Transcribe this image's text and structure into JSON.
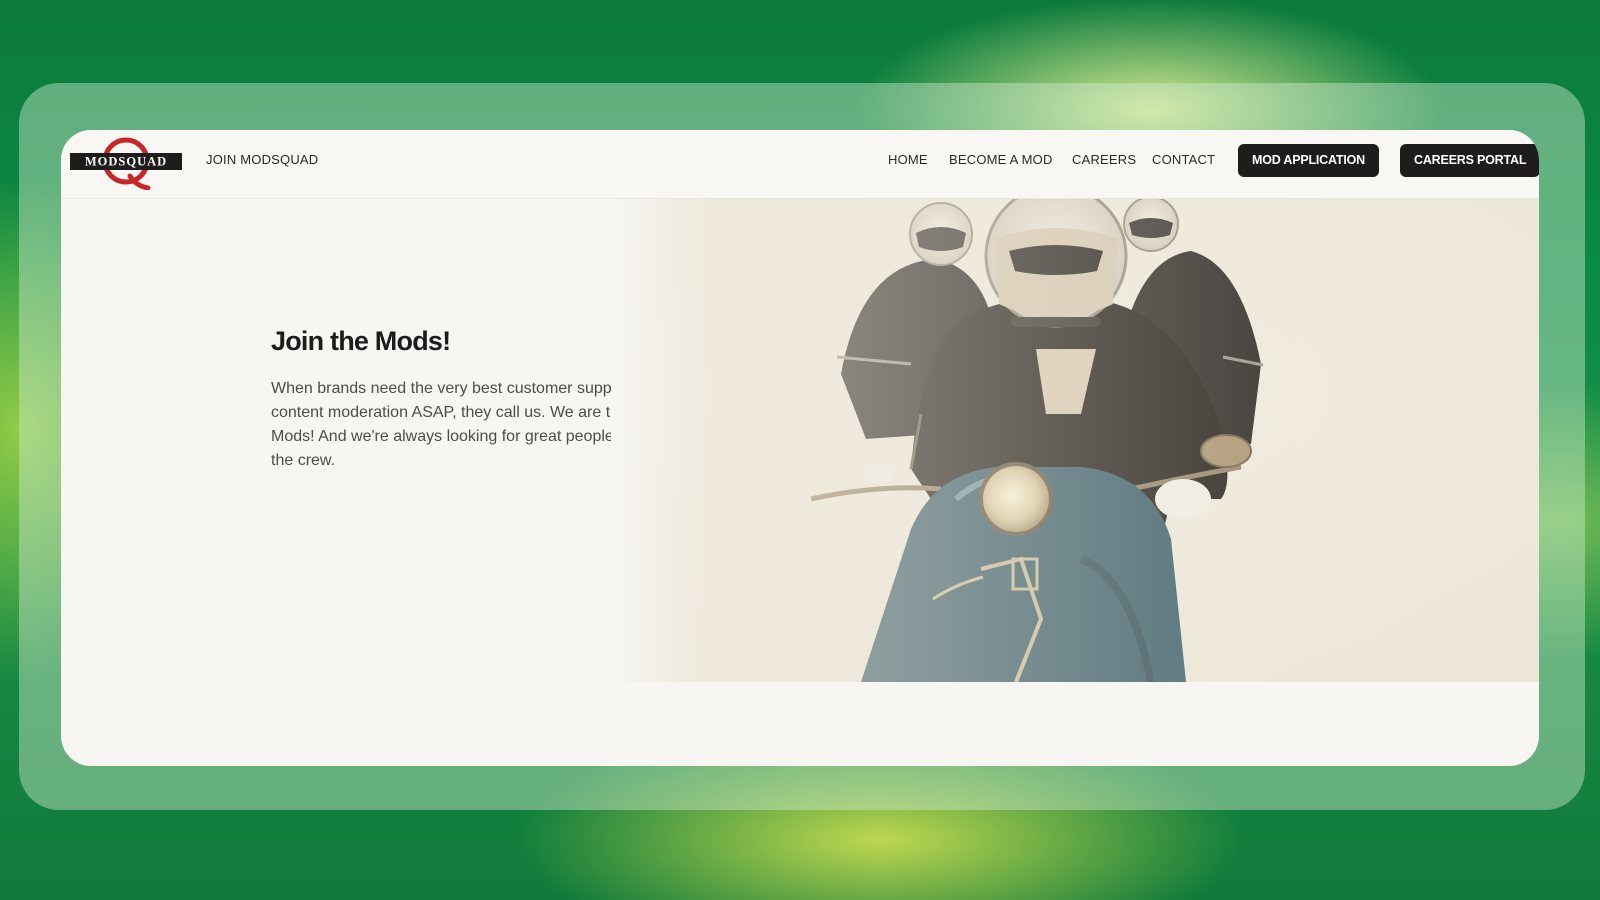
{
  "brand": {
    "logo_text": "MODSQUAD",
    "logo_color": "#c8262a"
  },
  "nav": {
    "join_label": "JOIN MODSQUAD",
    "links": [
      {
        "label": "HOME"
      },
      {
        "label": "BECOME A MOD"
      },
      {
        "label": "CAREERS"
      },
      {
        "label": "CONTACT"
      }
    ],
    "buttons": [
      {
        "label": "MOD APPLICATION"
      },
      {
        "label": "CAREERS PORTAL"
      }
    ]
  },
  "hero": {
    "title": "Join the Mods!",
    "body": "When brands need the very best customer support and content moderation ASAP, they call us. We are the Mods! And we're always looking for great people to join the crew."
  },
  "colors": {
    "button_bg": "#1e1d1b",
    "card_bg": "#f7f6f3",
    "scooter_blue": "#2f5563"
  },
  "icons": {
    "logo": "modsquad-q-logo"
  }
}
